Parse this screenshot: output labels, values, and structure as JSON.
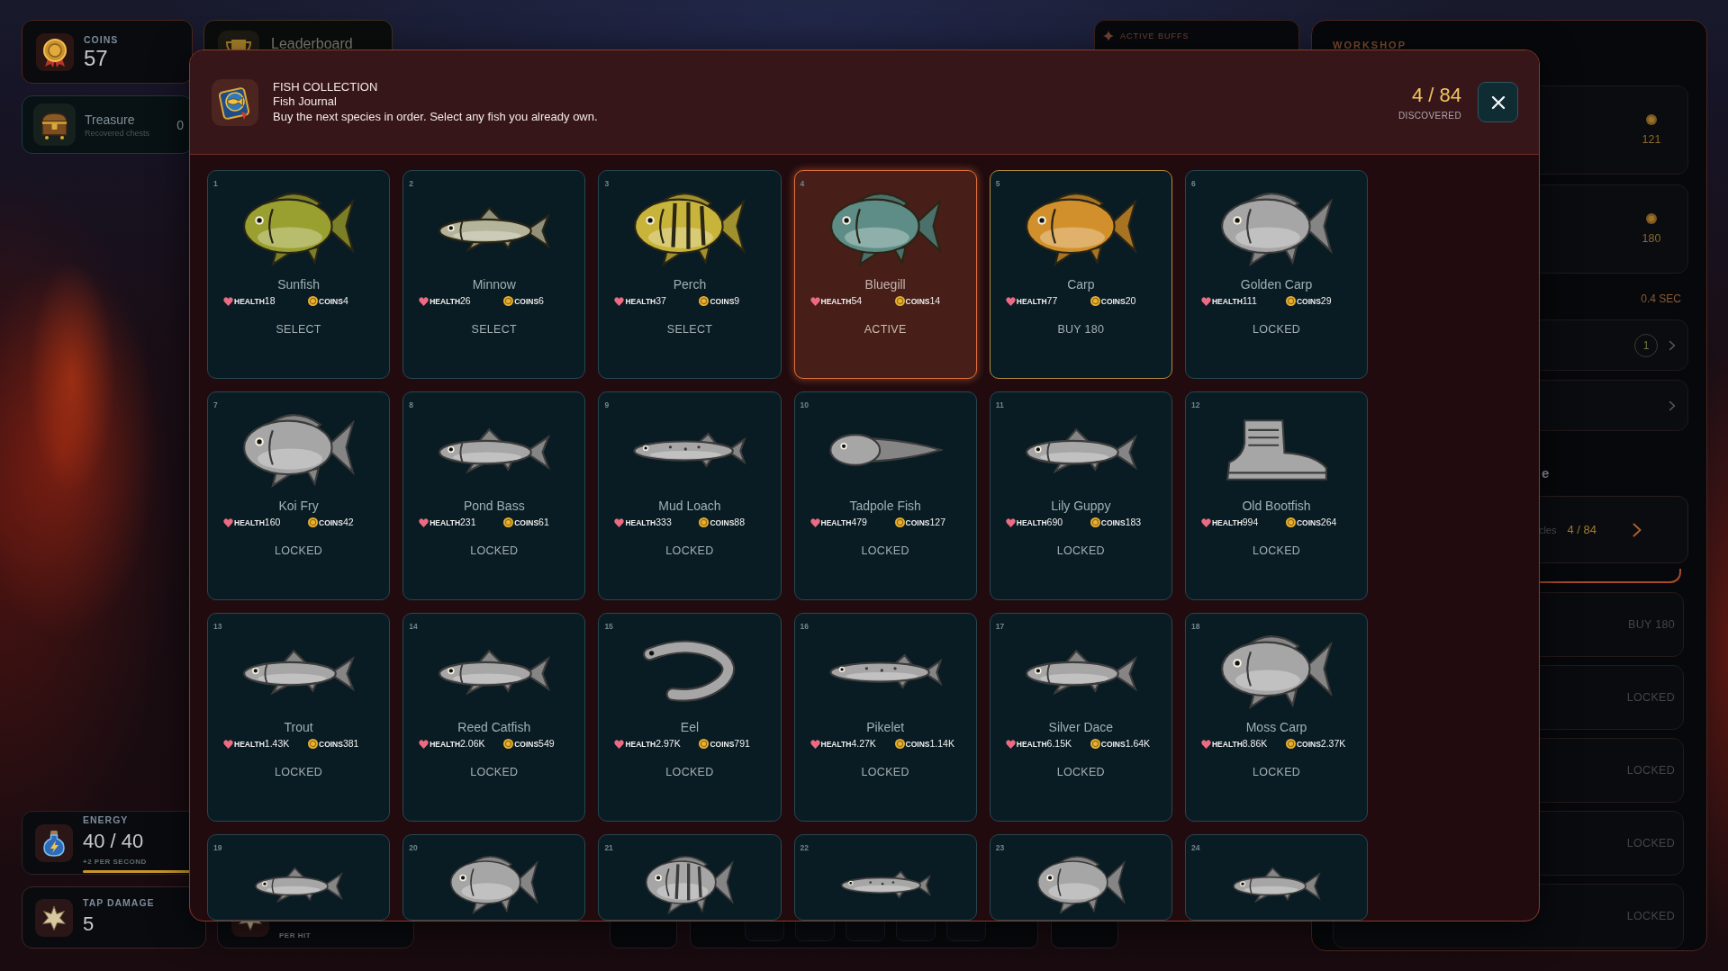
{
  "hud": {
    "coins": {
      "label": "COINS",
      "value": "57"
    },
    "leaderboard": {
      "label": "Leaderboard"
    },
    "treasure": {
      "title": "Treasure",
      "subtitle": "Recovered chests",
      "count": "0"
    },
    "active_buffs": {
      "label": "ACTIVE BUFFS"
    },
    "energy": {
      "label": "ENERGY",
      "value": "40 / 40",
      "rate": "+2 PER SECOND",
      "level": 1
    },
    "tap_damage": {
      "label": "TAP DAMAGE",
      "value": "5"
    },
    "per_hit": {
      "label": "PER HIT"
    }
  },
  "workshop": {
    "title": "WORKSHOP",
    "upgrades": [
      {
        "cost": "121"
      },
      {
        "cost": "180"
      }
    ],
    "interval": "0.4 SEC",
    "options": [
      {
        "kind": "badge",
        "badge": "1"
      },
      {
        "kind": "plain"
      }
    ],
    "heading": "e",
    "collection": {
      "label": "cles",
      "value": "4 / 84"
    },
    "items": [
      {
        "action": "BUY 180"
      },
      {
        "action": "LOCKED"
      },
      {
        "action": "LOCKED"
      },
      {
        "action": "LOCKED"
      },
      {
        "action": "LOCKED"
      }
    ]
  },
  "modal": {
    "title": "FISH COLLECTION",
    "subtitle": "Fish Journal",
    "description": "Buy the next species in order. Select any fish you already own.",
    "progress": "4 / 84",
    "progress_label": "DISCOVERED",
    "cards": [
      {
        "number": "1",
        "name": "Sunfish",
        "kind": "round",
        "color": "#9aa030",
        "health": "**HEALTH**18",
        "coins": "**COINS**4",
        "action": "SELECT",
        "locked": false,
        "purchasable": false,
        "selected": false
      },
      {
        "number": "2",
        "name": "Minnow",
        "kind": "slender",
        "color": "#b4b49a",
        "health": "**HEALTH**26",
        "coins": "**COINS**6",
        "action": "SELECT",
        "locked": false,
        "purchasable": false,
        "selected": false
      },
      {
        "number": "3",
        "name": "Perch",
        "kind": "striped",
        "color": "#c8b43a",
        "health": "**HEALTH**37",
        "coins": "**COINS**9",
        "action": "SELECT",
        "locked": false,
        "purchasable": false,
        "selected": false
      },
      {
        "number": "4",
        "name": "Bluegill",
        "kind": "round",
        "color": "#5e8c86",
        "health": "**HEALTH**54",
        "coins": "**COINS**14",
        "action": "ACTIVE",
        "locked": false,
        "purchasable": false,
        "selected": true
      },
      {
        "number": "5",
        "name": "Carp",
        "kind": "round",
        "color": "#d2902c",
        "health": "**HEALTH**77",
        "coins": "**COINS**20",
        "action": "BUY 180",
        "locked": false,
        "purchasable": true,
        "selected": false
      },
      {
        "number": "6",
        "name": "Golden Carp",
        "kind": "round",
        "health": "**HEALTH**111",
        "coins": "**COINS**29",
        "action": "LOCKED",
        "locked": true,
        "purchasable": false,
        "selected": false
      },
      {
        "number": "7",
        "name": "Koi Fry",
        "kind": "round",
        "health": "**HEALTH**160",
        "coins": "**COINS**42",
        "action": "LOCKED",
        "locked": true,
        "purchasable": false,
        "selected": false
      },
      {
        "number": "8",
        "name": "Pond Bass",
        "kind": "slender",
        "health": "**HEALTH**231",
        "coins": "**COINS**61",
        "action": "LOCKED",
        "locked": true,
        "purchasable": false,
        "selected": false
      },
      {
        "number": "9",
        "name": "Mud Loach",
        "kind": "long",
        "health": "**HEALTH**333",
        "coins": "**COINS**88",
        "action": "LOCKED",
        "locked": true,
        "purchasable": false,
        "selected": false
      },
      {
        "number": "10",
        "name": "Tadpole Fish",
        "kind": "tadpole",
        "health": "**HEALTH**479",
        "coins": "**COINS**127",
        "action": "LOCKED",
        "locked": true,
        "purchasable": false,
        "selected": false
      },
      {
        "number": "11",
        "name": "Lily Guppy",
        "kind": "slender",
        "health": "**HEALTH**690",
        "coins": "**COINS**183",
        "action": "LOCKED",
        "locked": true,
        "purchasable": false,
        "selected": false
      },
      {
        "number": "12",
        "name": "Old Bootfish",
        "kind": "boot",
        "health": "**HEALTH**994",
        "coins": "**COINS**264",
        "action": "LOCKED",
        "locked": true,
        "purchasable": false,
        "selected": false
      },
      {
        "number": "13",
        "name": "Trout",
        "kind": "slender",
        "health": "**HEALTH**1.43K",
        "coins": "**COINS**381",
        "action": "LOCKED",
        "locked": true,
        "purchasable": false,
        "selected": false
      },
      {
        "number": "14",
        "name": "Reed Catfish",
        "kind": "slender",
        "health": "**HEALTH**2.06K",
        "coins": "**COINS**549",
        "action": "LOCKED",
        "locked": true,
        "purchasable": false,
        "selected": false
      },
      {
        "number": "15",
        "name": "Eel",
        "kind": "eel",
        "health": "**HEALTH**2.97K",
        "coins": "**COINS**791",
        "action": "LOCKED",
        "locked": true,
        "purchasable": false,
        "selected": false
      },
      {
        "number": "16",
        "name": "Pikelet",
        "kind": "long",
        "health": "**HEALTH**4.27K",
        "coins": "**COINS**1.14K",
        "action": "LOCKED",
        "locked": true,
        "purchasable": false,
        "selected": false
      },
      {
        "number": "17",
        "name": "Silver Dace",
        "kind": "slender",
        "health": "**HEALTH**6.15K",
        "coins": "**COINS**1.64K",
        "action": "LOCKED",
        "locked": true,
        "purchasable": false,
        "selected": false
      },
      {
        "number": "18",
        "name": "Moss Carp",
        "kind": "round",
        "health": "**HEALTH**8.86K",
        "coins": "**COINS**2.37K",
        "action": "LOCKED",
        "locked": true,
        "purchasable": false,
        "selected": false
      },
      {
        "number": "19",
        "kind": "slender",
        "locked": true,
        "purchasable": false,
        "selected": false
      },
      {
        "number": "20",
        "kind": "round",
        "locked": true,
        "purchasable": false,
        "selected": false
      },
      {
        "number": "21",
        "kind": "striped",
        "locked": true,
        "purchasable": false,
        "selected": false
      },
      {
        "number": "22",
        "kind": "long",
        "locked": true,
        "purchasable": false,
        "selected": false
      },
      {
        "number": "23",
        "kind": "round",
        "locked": true,
        "purchasable": false,
        "selected": false
      },
      {
        "number": "24",
        "kind": "slender",
        "locked": true,
        "purchasable": false,
        "selected": false
      }
    ]
  }
}
